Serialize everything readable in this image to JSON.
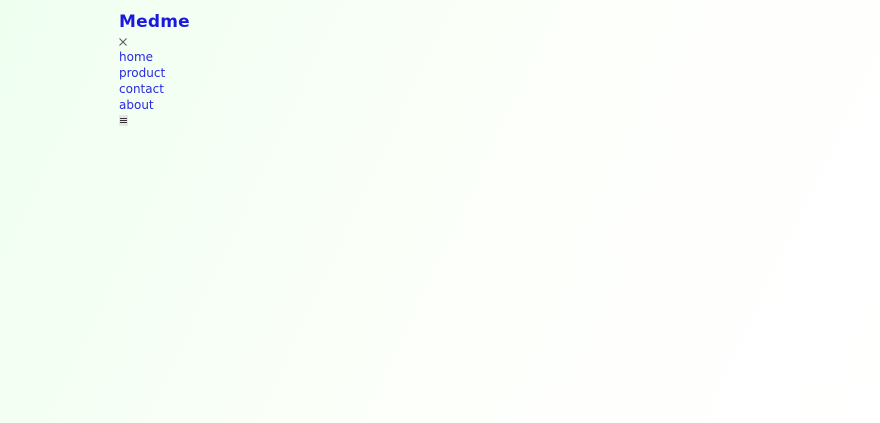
{
  "brand": {
    "name": "Medme"
  },
  "nav": {
    "items": [
      {
        "label": "home"
      },
      {
        "label": "product"
      },
      {
        "label": "contact"
      },
      {
        "label": "about"
      }
    ]
  },
  "icons": {
    "close": "close-icon",
    "menu": "hamburger-menu-icon"
  },
  "colors": {
    "brand": "#1a1adf",
    "link": "#2a2ae0",
    "background_start": "#eefff0",
    "background_end": "#ffffff"
  }
}
